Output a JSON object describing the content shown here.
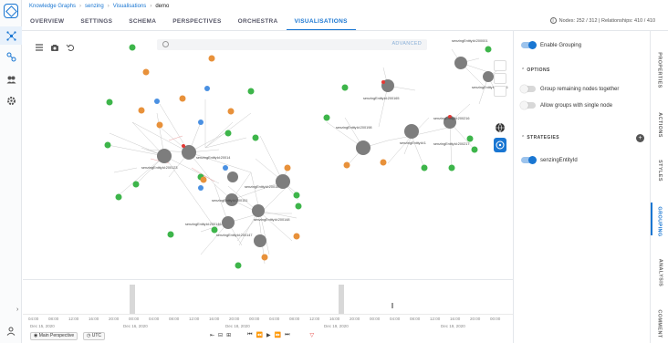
{
  "breadcrumbs": [
    "Knowledge Graphs",
    "senzing",
    "Visualisations",
    "demo"
  ],
  "tabs": [
    {
      "label": "OVERVIEW",
      "active": false
    },
    {
      "label": "SETTINGS",
      "active": false
    },
    {
      "label": "SCHEMA",
      "active": false
    },
    {
      "label": "PERSPECTIVES",
      "active": false
    },
    {
      "label": "ORCHESTRA",
      "active": false
    },
    {
      "label": "VISUALISATIONS",
      "active": true
    }
  ],
  "stats": {
    "text": "Nodes: 252 / 312 | Relationships: 410 / 410"
  },
  "search": {
    "advanced_label": "ADVANCED"
  },
  "graph": {
    "labels": {
      "a": "senzingEntityId:200123",
      "b": "senzingEntityId:20014",
      "c": "senzingEntityId:200151",
      "d": "senzingEntityId:20015",
      "e": "senzingEntityId:200148",
      "f": "senzingEntityId:200146",
      "g": "senzingEntityId:200147",
      "h": "senzingEntityId:200165",
      "i": "senzingEntityId:200198",
      "j": "senzingEntityId:1",
      "k": "senzingEntityId:200216",
      "l": "senzingEntityId:200217",
      "m": "senzingEntityId:200001",
      "n": "senzingEntityId:200026"
    }
  },
  "timeline": {
    "ticks": [
      "04:00",
      "08:00",
      "12:00",
      "16:00",
      "20:00",
      "00:00",
      "04:00",
      "08:00",
      "12:00",
      "16:00",
      "20:00",
      "00:00",
      "04:00",
      "08:00",
      "12:00",
      "16:00",
      "20:00",
      "00:00",
      "04:00",
      "08:00",
      "12:00",
      "16:00",
      "20:00",
      "00:00"
    ],
    "dates": [
      "Dec 15, 2020",
      "Dec 16, 2020",
      "Dec 18, 2020",
      "Dec 19, 2020",
      "Dec 19, 2020"
    ],
    "perspective_button": "Main Perspective",
    "timezone_button": "UTC"
  },
  "panel": {
    "enable_grouping": "Enable Grouping",
    "options_header": "OPTIONS",
    "group_remaining": "Group remaining nodes together",
    "allow_single": "Allow groups with single node",
    "strategies_header": "STRATEGIES",
    "strategy": "senzingEntityId"
  },
  "side_tabs": [
    {
      "label": "PROPERTIES",
      "active": false
    },
    {
      "label": "ACTIONS",
      "active": false
    },
    {
      "label": "STYLES",
      "active": false
    },
    {
      "label": "GROUPING",
      "active": true
    },
    {
      "label": "ANALYSIS",
      "active": false
    },
    {
      "label": "COMMENT",
      "active": false
    }
  ],
  "colors": {
    "accent": "#1976d2",
    "green": "#3db54a",
    "orange": "#e8913a",
    "gray": "#7d7d7d",
    "blue": "#4a90e2",
    "red": "#e53935"
  }
}
